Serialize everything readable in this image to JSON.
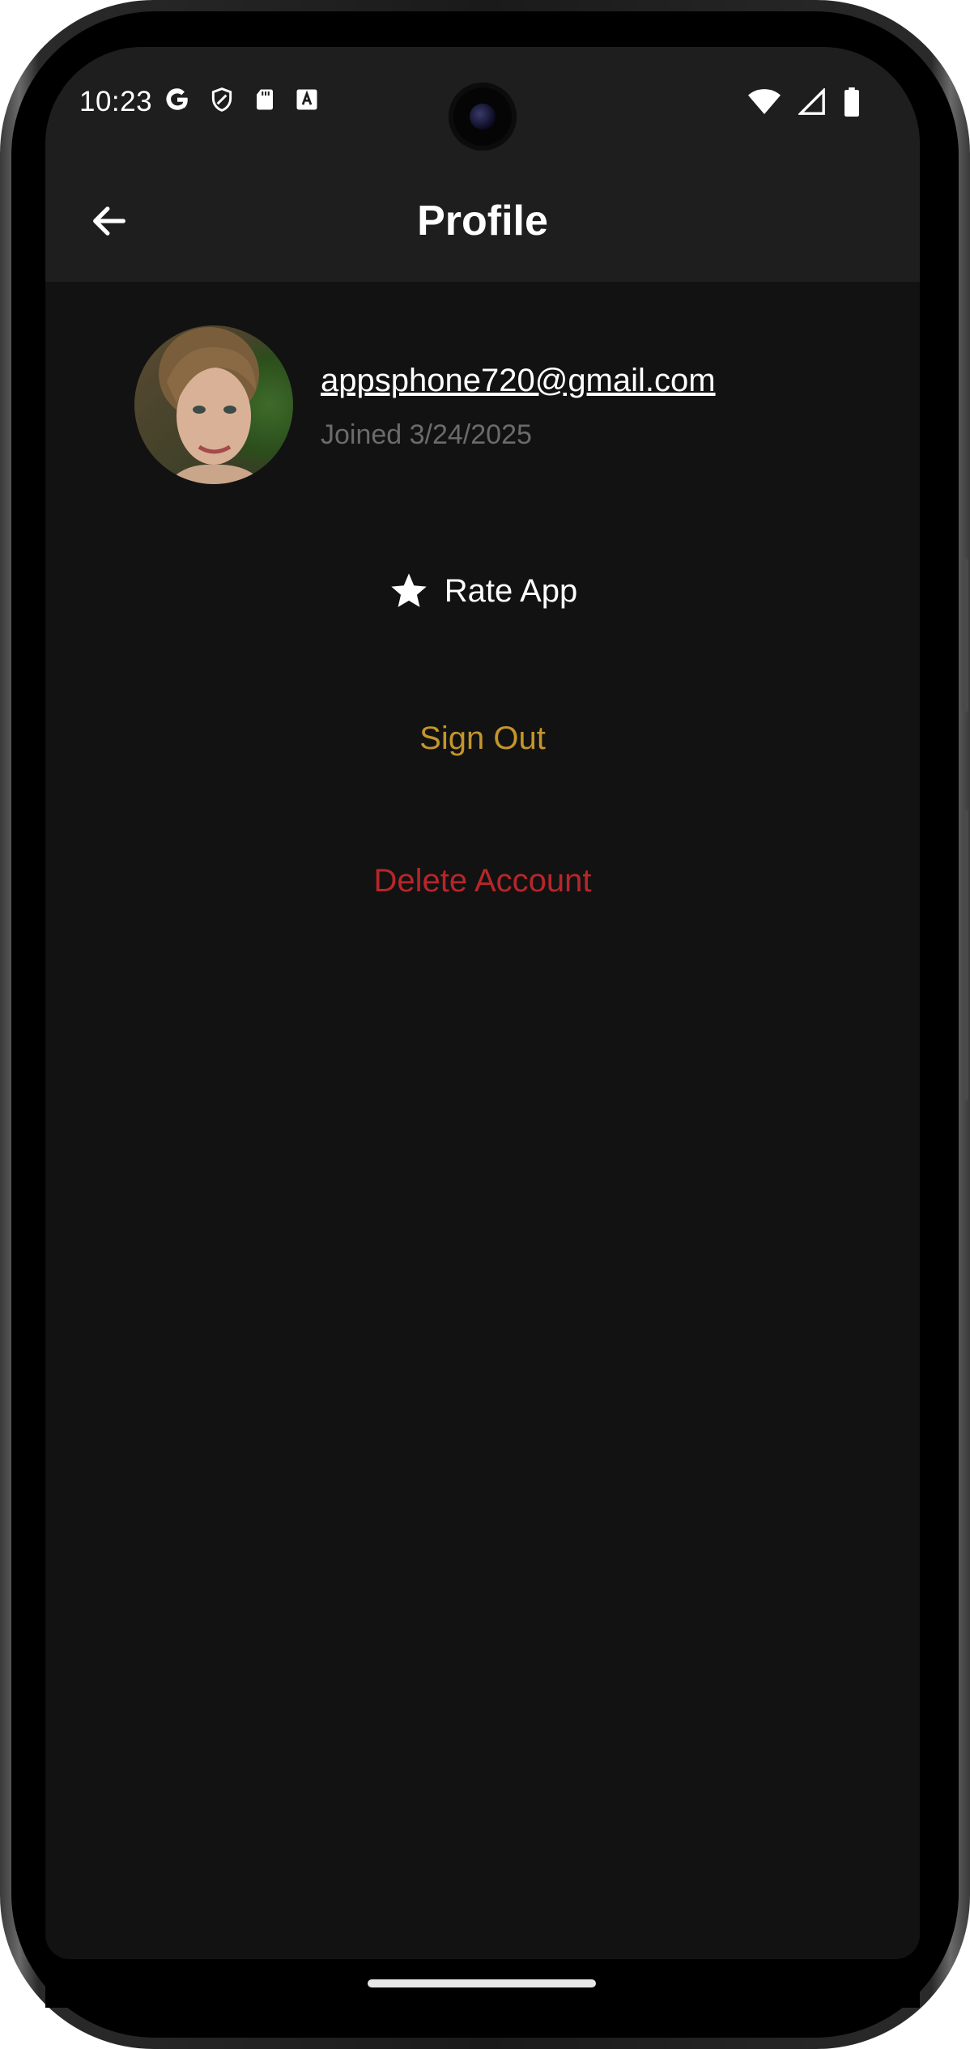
{
  "status_bar": {
    "time": "10:23",
    "left_icons": [
      "google-icon",
      "shield-icon",
      "sd-card-icon",
      "font-download-icon"
    ],
    "right_icons": [
      "wifi-icon",
      "signal-icon",
      "battery-icon"
    ]
  },
  "app_bar": {
    "title": "Profile",
    "back_icon": "arrow-left-icon"
  },
  "profile": {
    "email": "appsphone720@gmail.com",
    "joined": "Joined 3/24/2025"
  },
  "actions": {
    "rate_label": "Rate App",
    "rate_icon": "star-icon",
    "sign_out_label": "Sign Out",
    "delete_label": "Delete Account"
  },
  "colors": {
    "background": "#121212",
    "app_bar": "#1e1e1e",
    "sign_out": "#c4952a",
    "delete": "#b7262a",
    "muted_text": "#6b6b6b"
  }
}
